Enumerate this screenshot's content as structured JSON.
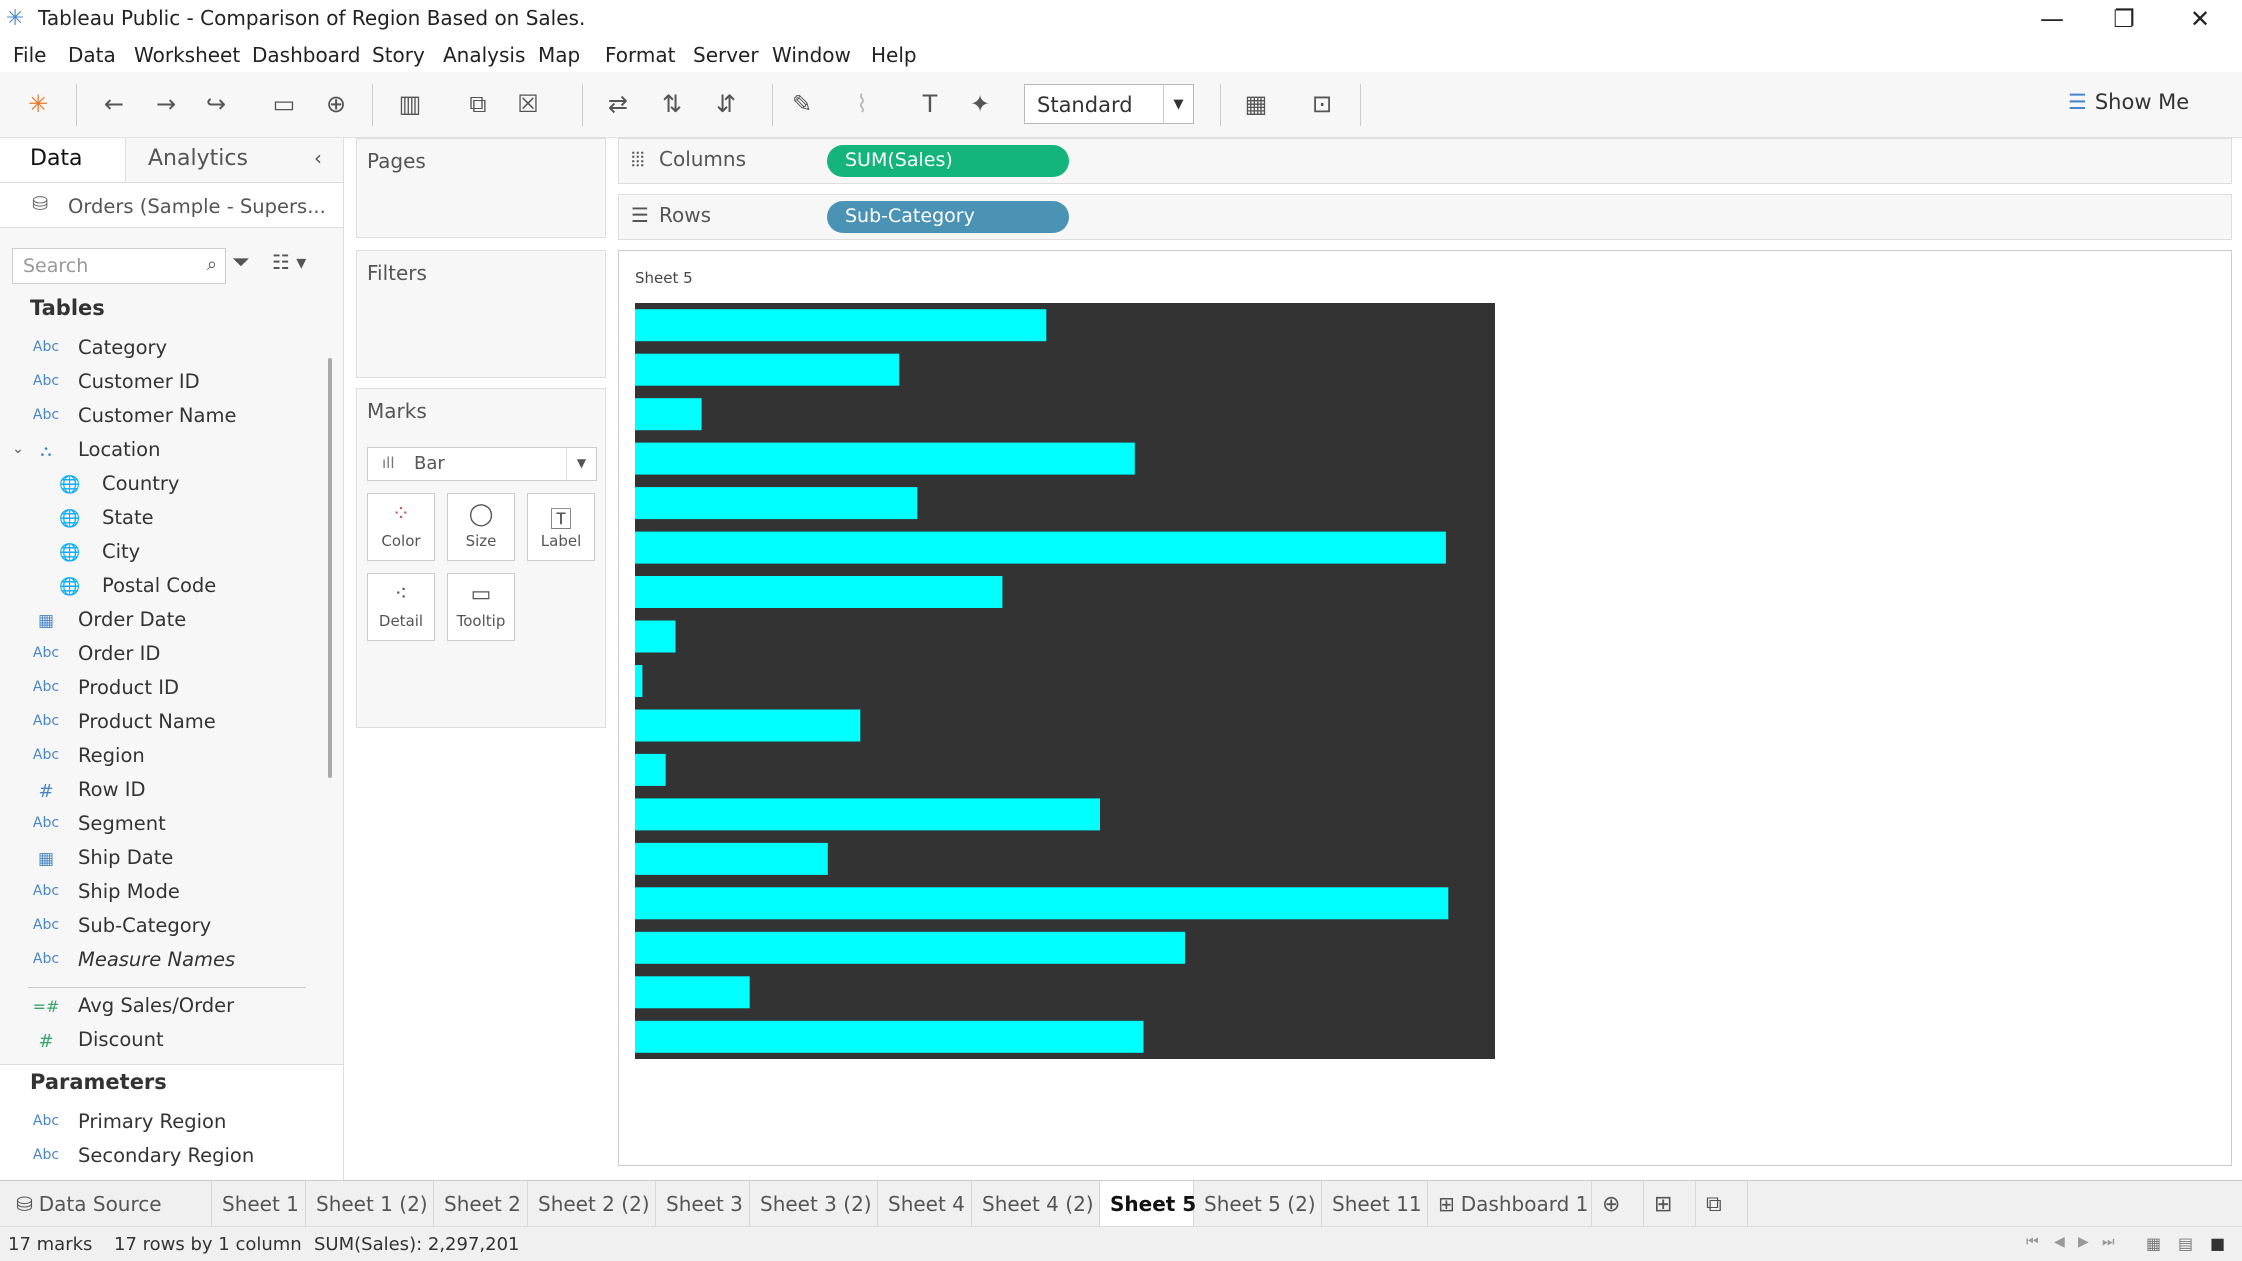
{
  "window": {
    "title": "Tableau Public - Comparison of Region Based on Sales.",
    "minimize": "—",
    "restore": "❐",
    "close": "✕"
  },
  "menu": [
    "File",
    "Data",
    "Worksheet",
    "Dashboard",
    "Story",
    "Analysis",
    "Map",
    "Format",
    "Server",
    "Window",
    "Help"
  ],
  "toolbar": {
    "fit": "Standard",
    "show_me": "Show Me"
  },
  "data_pane": {
    "tab_data": "Data",
    "tab_analytics": "Analytics",
    "datasource": "Orders (Sample - Supers...",
    "search_placeholder": "Search",
    "tables_header": "Tables",
    "fields": [
      {
        "type": "Abc",
        "name": "Category"
      },
      {
        "type": "Abc",
        "name": "Customer ID"
      },
      {
        "type": "Abc",
        "name": "Customer Name"
      },
      {
        "type": "hier",
        "name": "Location"
      },
      {
        "type": "geo",
        "name": "Country"
      },
      {
        "type": "geo",
        "name": "State"
      },
      {
        "type": "geo",
        "name": "City"
      },
      {
        "type": "geo",
        "name": "Postal Code"
      },
      {
        "type": "date",
        "name": "Order Date"
      },
      {
        "type": "Abc",
        "name": "Order ID"
      },
      {
        "type": "Abc",
        "name": "Product ID"
      },
      {
        "type": "Abc",
        "name": "Product Name"
      },
      {
        "type": "Abc",
        "name": "Region"
      },
      {
        "type": "#",
        "name": "Row ID"
      },
      {
        "type": "Abc",
        "name": "Segment"
      },
      {
        "type": "date",
        "name": "Ship Date"
      },
      {
        "type": "Abc",
        "name": "Ship Mode"
      },
      {
        "type": "Abc",
        "name": "Sub-Category"
      },
      {
        "type": "Abc",
        "name": "Measure Names"
      },
      {
        "type": "=#",
        "name": "Avg Sales/Order"
      },
      {
        "type": "#",
        "name": "Discount"
      }
    ],
    "parameters_header": "Parameters",
    "parameters": [
      {
        "type": "Abc",
        "name": "Primary Region"
      },
      {
        "type": "Abc",
        "name": "Secondary Region"
      }
    ]
  },
  "cards": {
    "pages": "Pages",
    "filters": "Filters",
    "marks": "Marks",
    "mark_type": "Bar",
    "buttons": {
      "color": "Color",
      "size": "Size",
      "label": "Label",
      "detail": "Detail",
      "tooltip": "Tooltip"
    }
  },
  "shelves": {
    "columns_label": "Columns",
    "columns_pill": "SUM(Sales)",
    "rows_label": "Rows",
    "rows_pill": "Sub-Category"
  },
  "sheet_title": "Sheet 5",
  "colors": {
    "bar": "#00ffff",
    "chart_bg": "#333333",
    "columns_pill": "#14b57d",
    "rows_pill": "#4b93b5"
  },
  "chart_data": {
    "type": "bar",
    "orientation": "horizontal",
    "measure": "SUM(Sales)",
    "dimension": "Sub-Category",
    "values": [
      167380,
      107532,
      27119,
      203413,
      114880,
      330007,
      149528,
      16476,
      3024,
      91705,
      12486,
      189239,
      78479,
      331001,
      223844,
      46674,
      206966
    ],
    "xlim": [
      0,
      350000
    ]
  },
  "tabs": [
    "Data Source",
    "Sheet 1",
    "Sheet 1 (2)",
    "Sheet 2",
    "Sheet 2 (2)",
    "Sheet 3",
    "Sheet 3 (2)",
    "Sheet 4",
    "Sheet 4 (2)",
    "Sheet 5",
    "Sheet 5 (2)",
    "Sheet 11",
    "Dashboard 1"
  ],
  "active_tab": "Sheet 5",
  "status": {
    "marks": "17 marks",
    "rows": "17 rows by 1 column",
    "sum": "SUM(Sales): 2,297,201"
  }
}
